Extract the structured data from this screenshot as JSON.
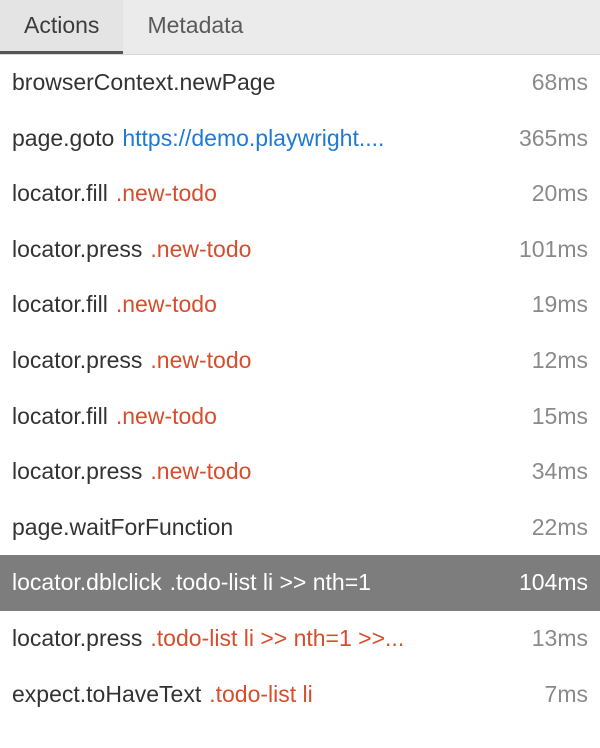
{
  "tabs": {
    "actions": "Actions",
    "metadata": "Metadata"
  },
  "actions": [
    {
      "api": "browserContext.newPage",
      "arg": "",
      "argType": "",
      "duration": "68ms",
      "selected": false
    },
    {
      "api": "page.goto",
      "arg": "https://demo.playwright....",
      "argType": "url",
      "duration": "365ms",
      "selected": false
    },
    {
      "api": "locator.fill",
      "arg": ".new-todo",
      "argType": "selector",
      "duration": "20ms",
      "selected": false
    },
    {
      "api": "locator.press",
      "arg": ".new-todo",
      "argType": "selector",
      "duration": "101ms",
      "selected": false
    },
    {
      "api": "locator.fill",
      "arg": ".new-todo",
      "argType": "selector",
      "duration": "19ms",
      "selected": false
    },
    {
      "api": "locator.press",
      "arg": ".new-todo",
      "argType": "selector",
      "duration": "12ms",
      "selected": false
    },
    {
      "api": "locator.fill",
      "arg": ".new-todo",
      "argType": "selector",
      "duration": "15ms",
      "selected": false
    },
    {
      "api": "locator.press",
      "arg": ".new-todo",
      "argType": "selector",
      "duration": "34ms",
      "selected": false
    },
    {
      "api": "page.waitForFunction",
      "arg": "",
      "argType": "",
      "duration": "22ms",
      "selected": false
    },
    {
      "api": "locator.dblclick",
      "arg": ".todo-list li >> nth=1",
      "argType": "selector",
      "duration": "104ms",
      "selected": true
    },
    {
      "api": "locator.press",
      "arg": ".todo-list li >> nth=1 >>...",
      "argType": "selector",
      "duration": "13ms",
      "selected": false
    },
    {
      "api": "expect.toHaveText",
      "arg": ".todo-list li",
      "argType": "selector",
      "duration": "7ms",
      "selected": false
    }
  ]
}
